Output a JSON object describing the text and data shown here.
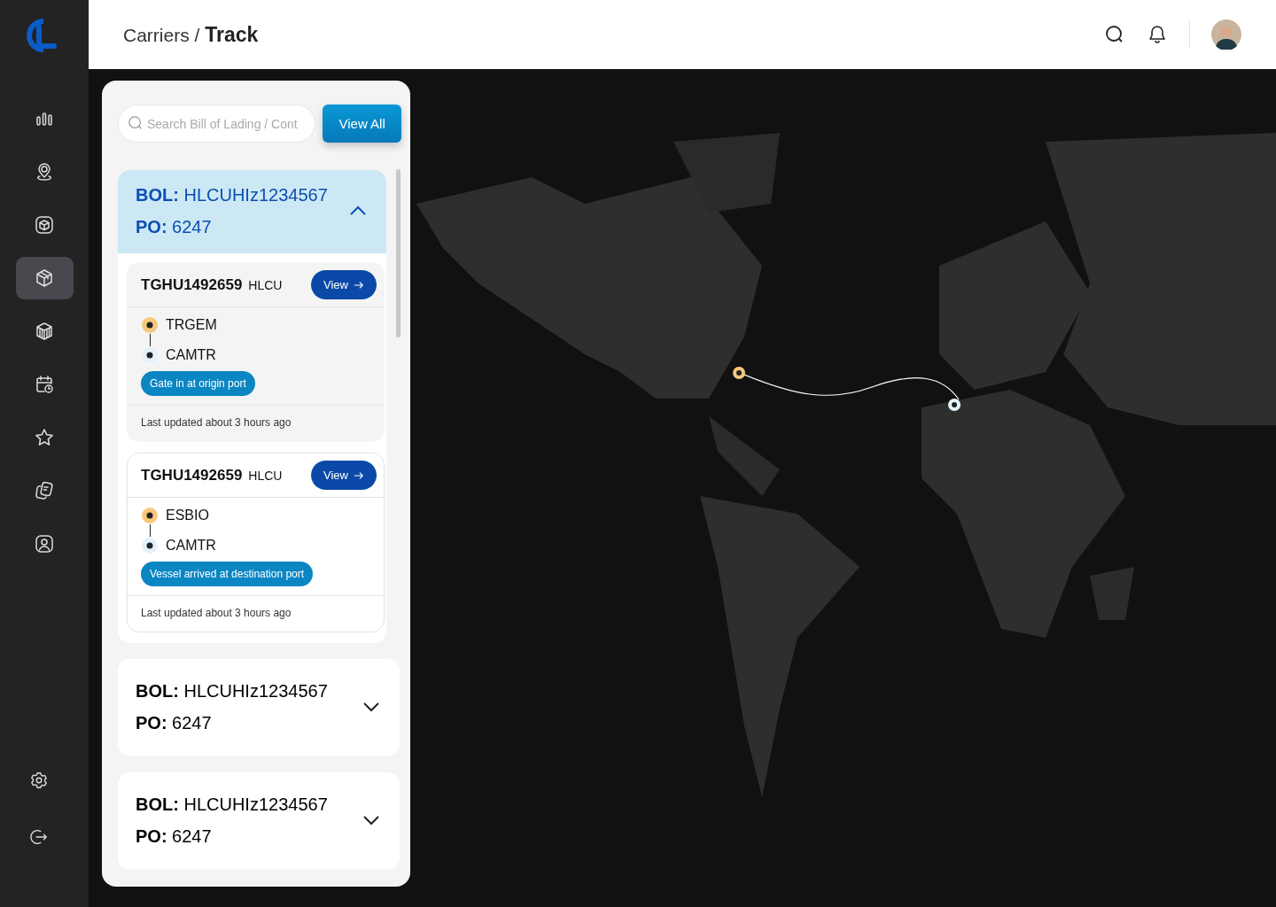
{
  "sidebar": {
    "items": [
      {
        "selected": false
      },
      {
        "selected": false
      },
      {
        "selected": false
      },
      {
        "selected": true
      },
      {
        "selected": false
      },
      {
        "selected": false
      },
      {
        "selected": false
      },
      {
        "selected": false
      },
      {
        "selected": false
      }
    ]
  },
  "header": {
    "breadcrumb": "Carriers /",
    "title": "Track"
  },
  "search": {
    "placeholder": "Search Bill of Lading / Cont"
  },
  "view_all_button": "View All",
  "shipments": [
    {
      "bol_label": "BOL:",
      "bol": "HLCUHIz1234567",
      "po_label": "PO:",
      "po": "6247",
      "expanded": true,
      "containers": [
        {
          "number": "TGHU1492659",
          "carrier": "HLCU",
          "button": "View",
          "origin": "TRGEM",
          "destination": "CAMTR",
          "status": "Gate in at origin port",
          "updated": "Last updated about 3 hours ago",
          "selected": true
        },
        {
          "number": "TGHU1492659",
          "carrier": "HLCU",
          "button": "View",
          "origin": "ESBIO",
          "destination": "CAMTR",
          "status": "Vessel arrived at destination port",
          "updated": "Last updated about 3 hours ago",
          "selected": false
        }
      ]
    },
    {
      "bol_label": "BOL:",
      "bol": "HLCUHIz1234567",
      "po_label": "PO:",
      "po": "6247",
      "expanded": false
    },
    {
      "bol_label": "BOL:",
      "bol": "HLCUHIz1234567",
      "po_label": "PO:",
      "po": "6247",
      "expanded": false
    }
  ]
}
